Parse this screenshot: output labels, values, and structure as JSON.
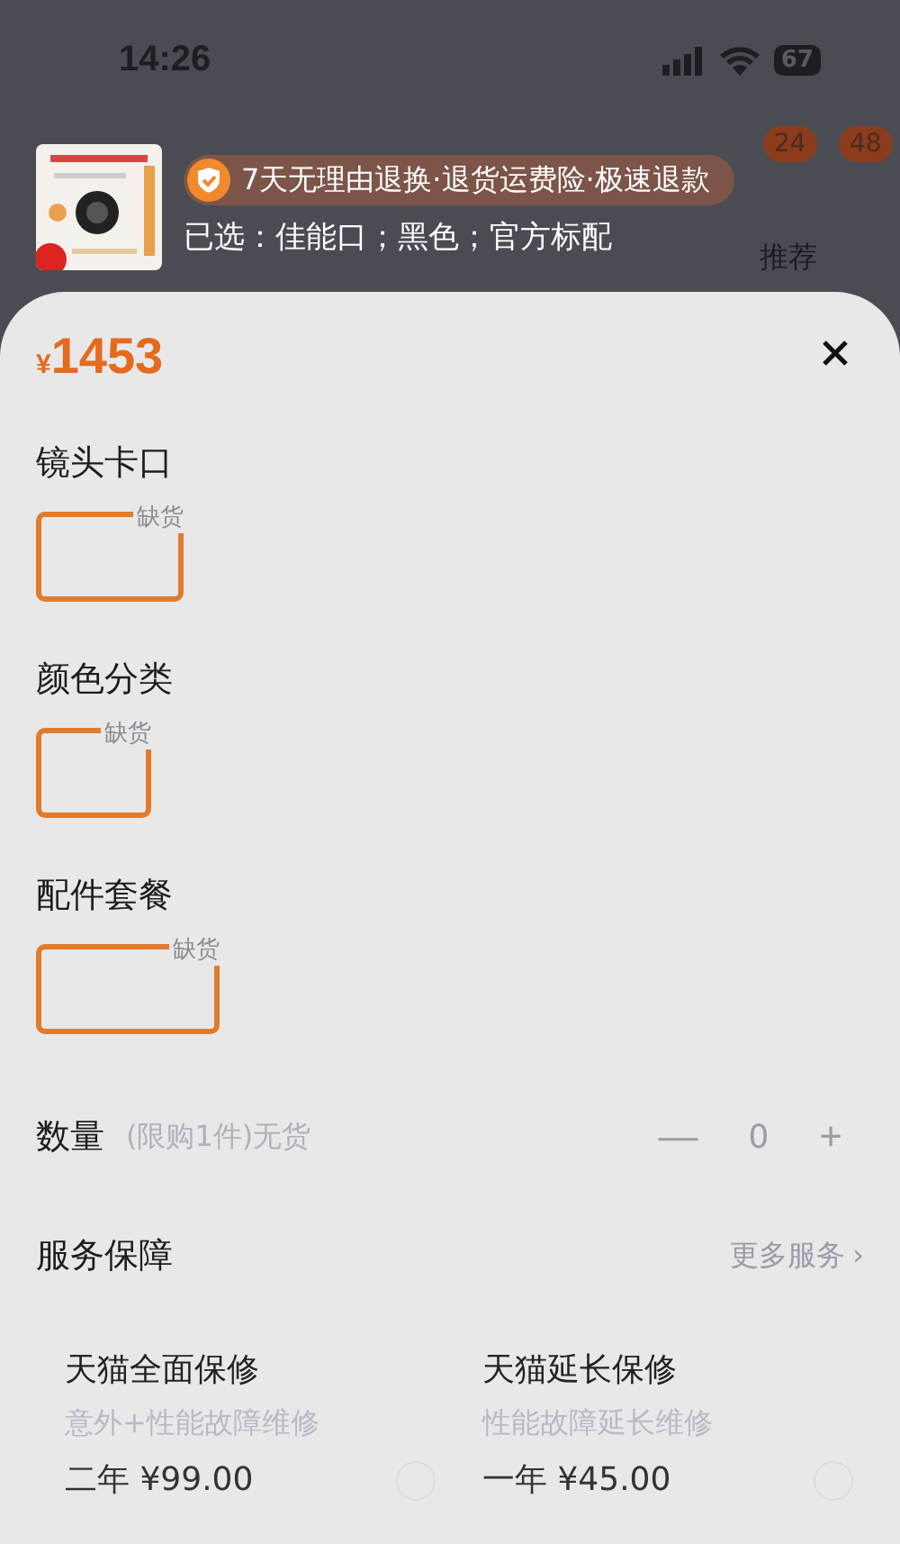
{
  "status_bar": {
    "time": "14:26",
    "battery": "67"
  },
  "header": {
    "badges": [
      "24",
      "48"
    ],
    "tab": "推荐",
    "banner": "7天无理由退换·退货运费险·极速退款",
    "selected_summary": "已选：佳能口；黑色；官方标配"
  },
  "sheet": {
    "currency": "¥",
    "price": "1453",
    "sections": [
      {
        "title": "镜头卡口",
        "options": [
          {
            "badge": "缺货"
          }
        ]
      },
      {
        "title": "颜色分类",
        "options": [
          {
            "badge": "缺货"
          }
        ]
      },
      {
        "title": "配件套餐",
        "options": [
          {
            "badge": "缺货"
          }
        ]
      }
    ],
    "quantity": {
      "label": "数量",
      "note": "(限购1件)无货",
      "minus": "—",
      "value": "0",
      "plus": "+",
      "disabled": true
    },
    "services": {
      "title": "服务保障",
      "more": "更多服务",
      "more_arrow": "›",
      "items": [
        {
          "name": "天猫全面保修",
          "desc": "意外+性能故障维修",
          "price": "二年 ¥99.00",
          "selected": false
        },
        {
          "name": "天猫延长保修",
          "desc": "性能故障延长维修",
          "price": "一年 ¥45.00",
          "selected": false
        }
      ]
    }
  }
}
